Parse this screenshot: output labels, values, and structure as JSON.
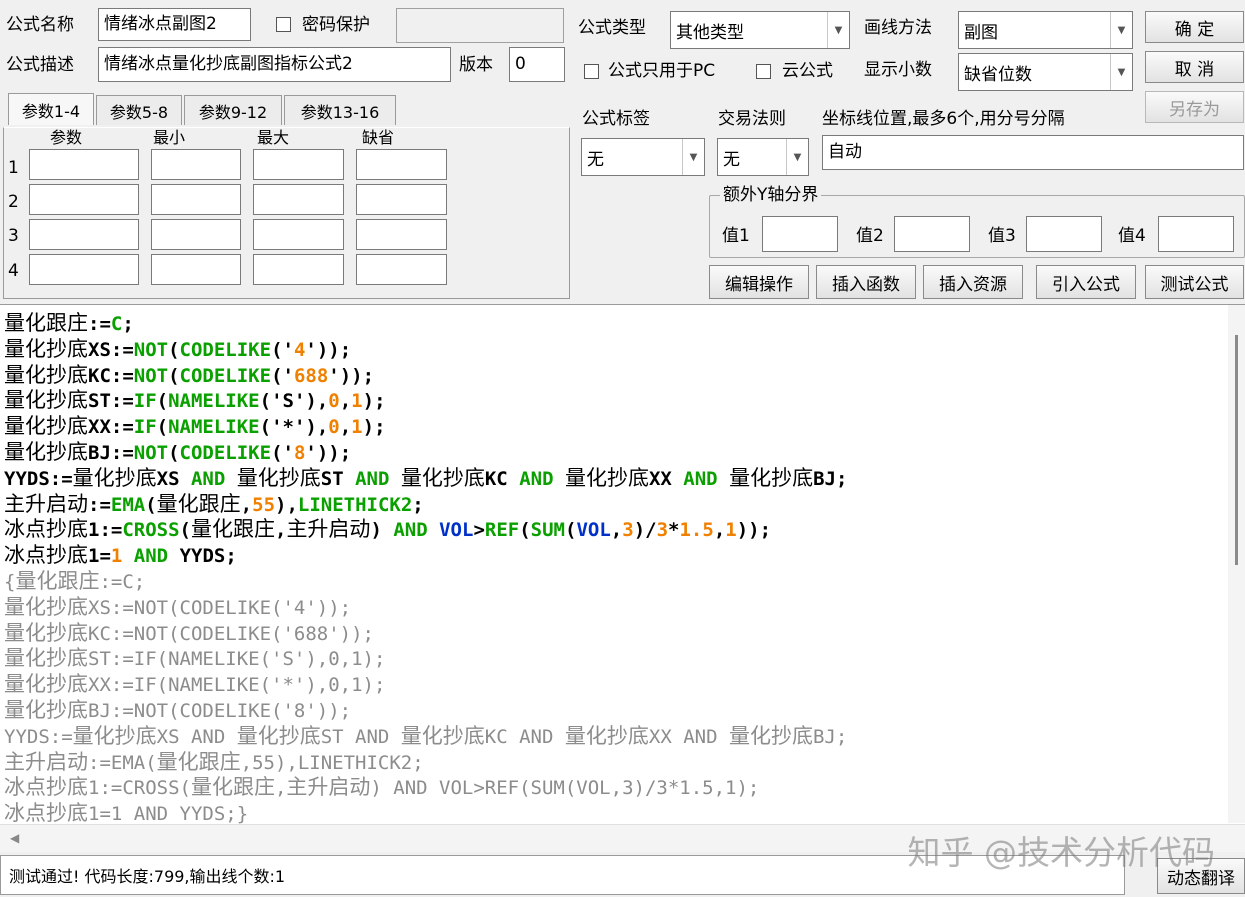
{
  "form": {
    "name_label": "公式名称",
    "name_value": "情绪冰点副图2",
    "password_label": "密码保护",
    "password_value": "",
    "desc_label": "公式描述",
    "desc_value": "情绪冰点量化抄底副图指标公式2",
    "version_label": "版本",
    "version_value": "0",
    "type_label": "公式类型",
    "type_value": "其他类型",
    "draw_label": "画线方法",
    "draw_value": "副图",
    "pc_only_label": "公式只用于PC",
    "cloud_label": "云公式",
    "decimals_label": "显示小数",
    "decimals_value": "缺省位数",
    "tag_label": "公式标签",
    "tag_value": "无",
    "rule_label": "交易法则",
    "rule_value": "无",
    "coord_label": "坐标线位置,最多6个,用分号分隔",
    "coord_value": "自动",
    "yaxis_group_label": "额外Y轴分界",
    "y_values": [
      {
        "label": "值1",
        "value": ""
      },
      {
        "label": "值2",
        "value": ""
      },
      {
        "label": "值3",
        "value": ""
      },
      {
        "label": "值4",
        "value": ""
      }
    ]
  },
  "buttons": {
    "ok": "确  定",
    "cancel": "取  消",
    "save_as": "另存为",
    "edit_ops": "编辑操作",
    "insert_func": "插入函数",
    "insert_res": "插入资源",
    "import_formula": "引入公式",
    "test_formula": "测试公式",
    "dynamic_translate": "动态翻译"
  },
  "param_tabs": [
    "参数1-4",
    "参数5-8",
    "参数9-12",
    "参数13-16"
  ],
  "param_headers": [
    "参数",
    "最小",
    "最大",
    "缺省"
  ],
  "param_rows": [
    "1",
    "2",
    "3",
    "4"
  ],
  "code_lines": [
    [
      [
        "k",
        "量化跟庄"
      ],
      [
        "k",
        ":="
      ],
      [
        "g",
        "C"
      ],
      [
        "k",
        ";"
      ]
    ],
    [
      [
        "k",
        "量化抄底"
      ],
      [
        "k",
        "XS:="
      ],
      [
        "g",
        "NOT"
      ],
      [
        "k",
        "("
      ],
      [
        "g",
        "CODELIKE"
      ],
      [
        "k",
        "('"
      ],
      [
        "o",
        "4"
      ],
      [
        "k",
        "'));"
      ]
    ],
    [
      [
        "k",
        "量化抄底"
      ],
      [
        "k",
        "KC:="
      ],
      [
        "g",
        "NOT"
      ],
      [
        "k",
        "("
      ],
      [
        "g",
        "CODELIKE"
      ],
      [
        "k",
        "('"
      ],
      [
        "o",
        "688"
      ],
      [
        "k",
        "'));"
      ]
    ],
    [
      [
        "k",
        "量化抄底"
      ],
      [
        "k",
        "ST:="
      ],
      [
        "g",
        "IF"
      ],
      [
        "k",
        "("
      ],
      [
        "g",
        "NAMELIKE"
      ],
      [
        "k",
        "('S'),"
      ],
      [
        "o",
        "0"
      ],
      [
        "k",
        ","
      ],
      [
        "o",
        "1"
      ],
      [
        "k",
        ");"
      ]
    ],
    [
      [
        "k",
        "量化抄底"
      ],
      [
        "k",
        "XX:="
      ],
      [
        "g",
        "IF"
      ],
      [
        "k",
        "("
      ],
      [
        "g",
        "NAMELIKE"
      ],
      [
        "k",
        "('*'),"
      ],
      [
        "o",
        "0"
      ],
      [
        "k",
        ","
      ],
      [
        "o",
        "1"
      ],
      [
        "k",
        ");"
      ]
    ],
    [
      [
        "k",
        "量化抄底"
      ],
      [
        "k",
        "BJ:="
      ],
      [
        "g",
        "NOT"
      ],
      [
        "k",
        "("
      ],
      [
        "g",
        "CODELIKE"
      ],
      [
        "k",
        "('"
      ],
      [
        "o",
        "8"
      ],
      [
        "k",
        "'));"
      ]
    ],
    [
      [
        "k",
        "YYDS:="
      ],
      [
        "k",
        "量化抄底"
      ],
      [
        "k",
        "XS "
      ],
      [
        "g",
        "AND"
      ],
      [
        "k",
        " "
      ],
      [
        "k",
        "量化抄底"
      ],
      [
        "k",
        "ST "
      ],
      [
        "g",
        "AND"
      ],
      [
        "k",
        " "
      ],
      [
        "k",
        "量化抄底"
      ],
      [
        "k",
        "KC "
      ],
      [
        "g",
        "AND"
      ],
      [
        "k",
        " "
      ],
      [
        "k",
        "量化抄底"
      ],
      [
        "k",
        "XX "
      ],
      [
        "g",
        "AND"
      ],
      [
        "k",
        " "
      ],
      [
        "k",
        "量化抄底"
      ],
      [
        "k",
        "BJ;"
      ]
    ],
    [
      [
        "k",
        "主升启动"
      ],
      [
        "k",
        ":="
      ],
      [
        "g",
        "EMA"
      ],
      [
        "k",
        "("
      ],
      [
        "k",
        "量化跟庄"
      ],
      [
        "k",
        ","
      ],
      [
        "o",
        "55"
      ],
      [
        "k",
        "),"
      ],
      [
        "g",
        "LINETHICK2"
      ],
      [
        "k",
        ";"
      ]
    ],
    [
      [
        "k",
        "冰点抄底"
      ],
      [
        "k",
        "1:="
      ],
      [
        "g",
        "CROSS"
      ],
      [
        "k",
        "("
      ],
      [
        "k",
        "量化跟庄"
      ],
      [
        "k",
        ","
      ],
      [
        "k",
        "主升启动"
      ],
      [
        "k",
        ") "
      ],
      [
        "g",
        "AND"
      ],
      [
        "k",
        " "
      ],
      [
        "b",
        "VOL"
      ],
      [
        "k",
        ">"
      ],
      [
        "g",
        "REF"
      ],
      [
        "k",
        "("
      ],
      [
        "g",
        "SUM"
      ],
      [
        "k",
        "("
      ],
      [
        "b",
        "VOL"
      ],
      [
        "k",
        ","
      ],
      [
        "o",
        "3"
      ],
      [
        "k",
        ")/"
      ],
      [
        "o",
        "3"
      ],
      [
        "k",
        "*"
      ],
      [
        "o",
        "1.5"
      ],
      [
        "k",
        ","
      ],
      [
        "o",
        "1"
      ],
      [
        "k",
        "));"
      ]
    ],
    [
      [
        "k",
        "冰点抄底"
      ],
      [
        "k",
        "1="
      ],
      [
        "o",
        "1"
      ],
      [
        "k",
        " "
      ],
      [
        "g",
        "AND"
      ],
      [
        "k",
        " YYDS;"
      ]
    ],
    [
      [
        "x",
        "{"
      ],
      [
        "x",
        "量化跟庄"
      ],
      [
        "x",
        ":=C;"
      ]
    ],
    [
      [
        "x",
        "量化抄底"
      ],
      [
        "x",
        "XS:=NOT(CODELIKE('4'));"
      ]
    ],
    [
      [
        "x",
        "量化抄底"
      ],
      [
        "x",
        "KC:=NOT(CODELIKE('688'));"
      ]
    ],
    [
      [
        "x",
        "量化抄底"
      ],
      [
        "x",
        "ST:=IF(NAMELIKE('S'),0,1);"
      ]
    ],
    [
      [
        "x",
        "量化抄底"
      ],
      [
        "x",
        "XX:=IF(NAMELIKE('*'),0,1);"
      ]
    ],
    [
      [
        "x",
        "量化抄底"
      ],
      [
        "x",
        "BJ:=NOT(CODELIKE('8'));"
      ]
    ],
    [
      [
        "x",
        "YYDS:="
      ],
      [
        "x",
        "量化抄底"
      ],
      [
        "x",
        "XS AND "
      ],
      [
        "x",
        "量化抄底"
      ],
      [
        "x",
        "ST AND "
      ],
      [
        "x",
        "量化抄底"
      ],
      [
        "x",
        "KC AND "
      ],
      [
        "x",
        "量化抄底"
      ],
      [
        "x",
        "XX AND "
      ],
      [
        "x",
        "量化抄底"
      ],
      [
        "x",
        "BJ;"
      ]
    ],
    [
      [
        "x",
        "主升启动"
      ],
      [
        "x",
        ":=EMA("
      ],
      [
        "x",
        "量化跟庄"
      ],
      [
        "x",
        ",55),LINETHICK2;"
      ]
    ],
    [
      [
        "x",
        "冰点抄底"
      ],
      [
        "x",
        "1:=CROSS("
      ],
      [
        "x",
        "量化跟庄"
      ],
      [
        "x",
        ","
      ],
      [
        "x",
        "主升启动"
      ],
      [
        "x",
        ") AND VOL>REF(SUM(VOL,3)/3*1.5,1);"
      ]
    ],
    [
      [
        "x",
        "冰点抄底"
      ],
      [
        "x",
        "1=1 AND YYDS;}"
      ]
    ]
  ],
  "status_text": "测试通过! 代码长度:799,输出线个数:1",
  "watermark": "知乎 @技术分析代码",
  "icons": {
    "dropdown": "chevron-down-icon",
    "scroll_left": "arrow-left-icon"
  }
}
